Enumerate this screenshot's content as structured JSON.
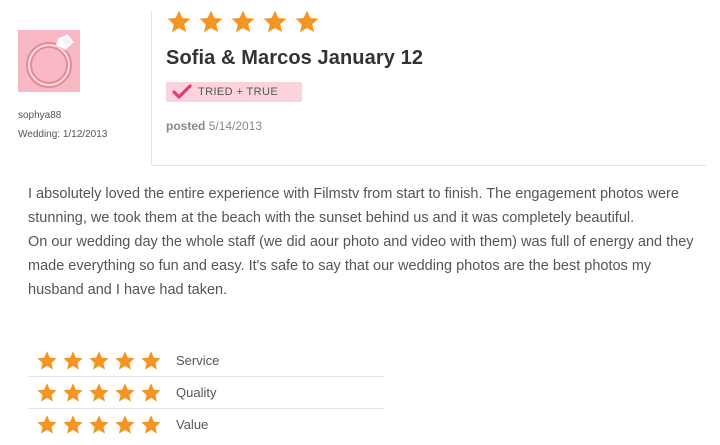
{
  "reviewer": {
    "username": "sophya88",
    "wedding_date": "Wedding: 1/12/2013",
    "avatar_icon": "ring-icon"
  },
  "review": {
    "rating_stars": 5,
    "title": "Sofia & Marcos January 12",
    "badge": "TRIED + TRUE",
    "posted_label": "posted",
    "posted_date": "5/14/2013",
    "body": [
      "I absolutely loved the entire experience with Filmstv from start to finish. The engagement photos were stunning, we took them at the beach with the sunset behind us and it was completely beautiful.",
      "On our wedding day the whole staff (we did aour photo and video with them) was full of energy and they made everything so fun and easy. It's safe to say that our wedding photos are the best photos my husband and I have had taken."
    ]
  },
  "ratings": [
    {
      "label": "Service",
      "stars": 5
    },
    {
      "label": "Quality",
      "stars": 5
    },
    {
      "label": "Value",
      "stars": 5
    }
  ],
  "colors": {
    "star": "#f39423",
    "badge_bg": "#fbd3dd",
    "check": "#e8386d",
    "avatar_bg": "#f7b8c3"
  }
}
